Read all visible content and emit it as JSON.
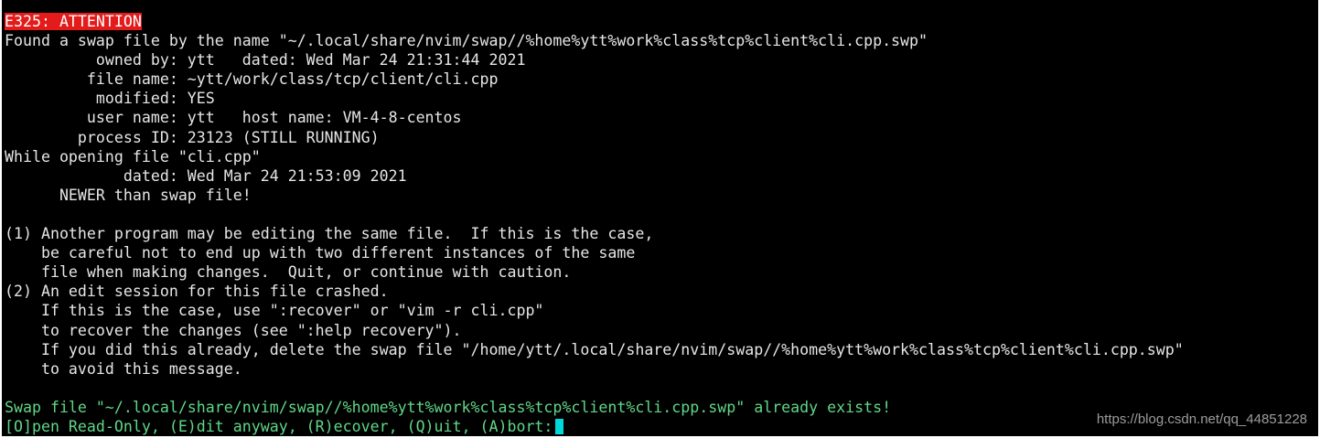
{
  "terminal": {
    "error_code": "E325: ATTENTION",
    "lines": [
      "Found a swap file by the name \"~/.local/share/nvim/swap//%home%ytt%work%class%tcp%client%cli.cpp.swp\"",
      "          owned by: ytt   dated: Wed Mar 24 21:31:44 2021",
      "         file name: ~ytt/work/class/tcp/client/cli.cpp",
      "          modified: YES",
      "         user name: ytt   host name: VM-4-8-centos",
      "        process ID: 23123 (STILL RUNNING)",
      "While opening file \"cli.cpp\"",
      "             dated: Wed Mar 24 21:53:09 2021",
      "      NEWER than swap file!",
      "",
      "(1) Another program may be editing the same file.  If this is the case,",
      "    be careful not to end up with two different instances of the same",
      "    file when making changes.  Quit, or continue with caution.",
      "(2) An edit session for this file crashed.",
      "    If this is the case, use \":recover\" or \"vim -r cli.cpp\"",
      "    to recover the changes (see \":help recovery\").",
      "    If you did this already, delete the swap file \"/home/ytt/.local/share/nvim/swap//%home%ytt%work%class%tcp%client%cli.cpp.swp\"",
      "    to avoid this message.",
      ""
    ],
    "swap_exists_message": "Swap file \"~/.local/share/nvim/swap//%home%ytt%work%class%tcp%client%cli.cpp.swp\" already exists!",
    "prompt": "[O]pen Read-Only, (E)dit anyway, (R)ecover, (Q)uit, (A)bort:"
  },
  "watermark": "https://blog.csdn.net/qq_44851228",
  "colors": {
    "background": "#000000",
    "text": "#e6e6e6",
    "error_bg": "#e31b1b",
    "prompt_green": "#5fd787",
    "cursor": "#00d7d7"
  }
}
